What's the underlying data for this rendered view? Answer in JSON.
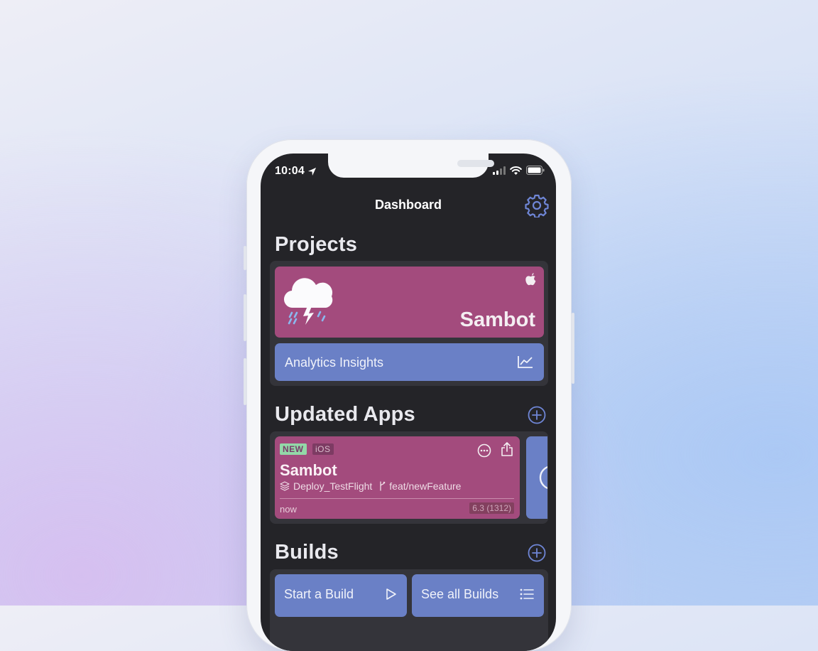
{
  "status_bar": {
    "time": "10:04",
    "icons": [
      "location-arrow-icon",
      "cellular-signal-icon",
      "wifi-icon",
      "battery-icon"
    ]
  },
  "nav": {
    "title": "Dashboard",
    "settings_icon": "gear-icon"
  },
  "projects": {
    "title": "Projects",
    "card": {
      "name": "Sambot",
      "platform_icon": "apple-logo-icon",
      "avatar_icon": "storm-cloud-icon"
    },
    "insights_label": "Analytics Insights",
    "insights_icon": "line-chart-icon"
  },
  "updated_apps": {
    "title": "Updated Apps",
    "add_icon": "plus-circle-icon",
    "card": {
      "badge_new": "NEW",
      "badge_platform": "iOS",
      "name": "Sambot",
      "workflow": "Deploy_TestFlight",
      "branch": "feat/newFeature",
      "time": "now",
      "version": "6.3 (1312)",
      "more_icon": "ellipsis-circle-icon",
      "share_icon": "share-icon"
    }
  },
  "builds": {
    "title": "Builds",
    "add_icon": "plus-circle-icon",
    "start_label": "Start a Build",
    "start_icon": "play-icon",
    "see_all_label": "See all Builds",
    "see_all_icon": "list-icon"
  },
  "colors": {
    "screen_bg": "#242428",
    "panel_bg": "#34343a",
    "accent_pink": "#a34b7d",
    "accent_blue": "#6a80c6",
    "badge_green": "#93d8a8"
  }
}
